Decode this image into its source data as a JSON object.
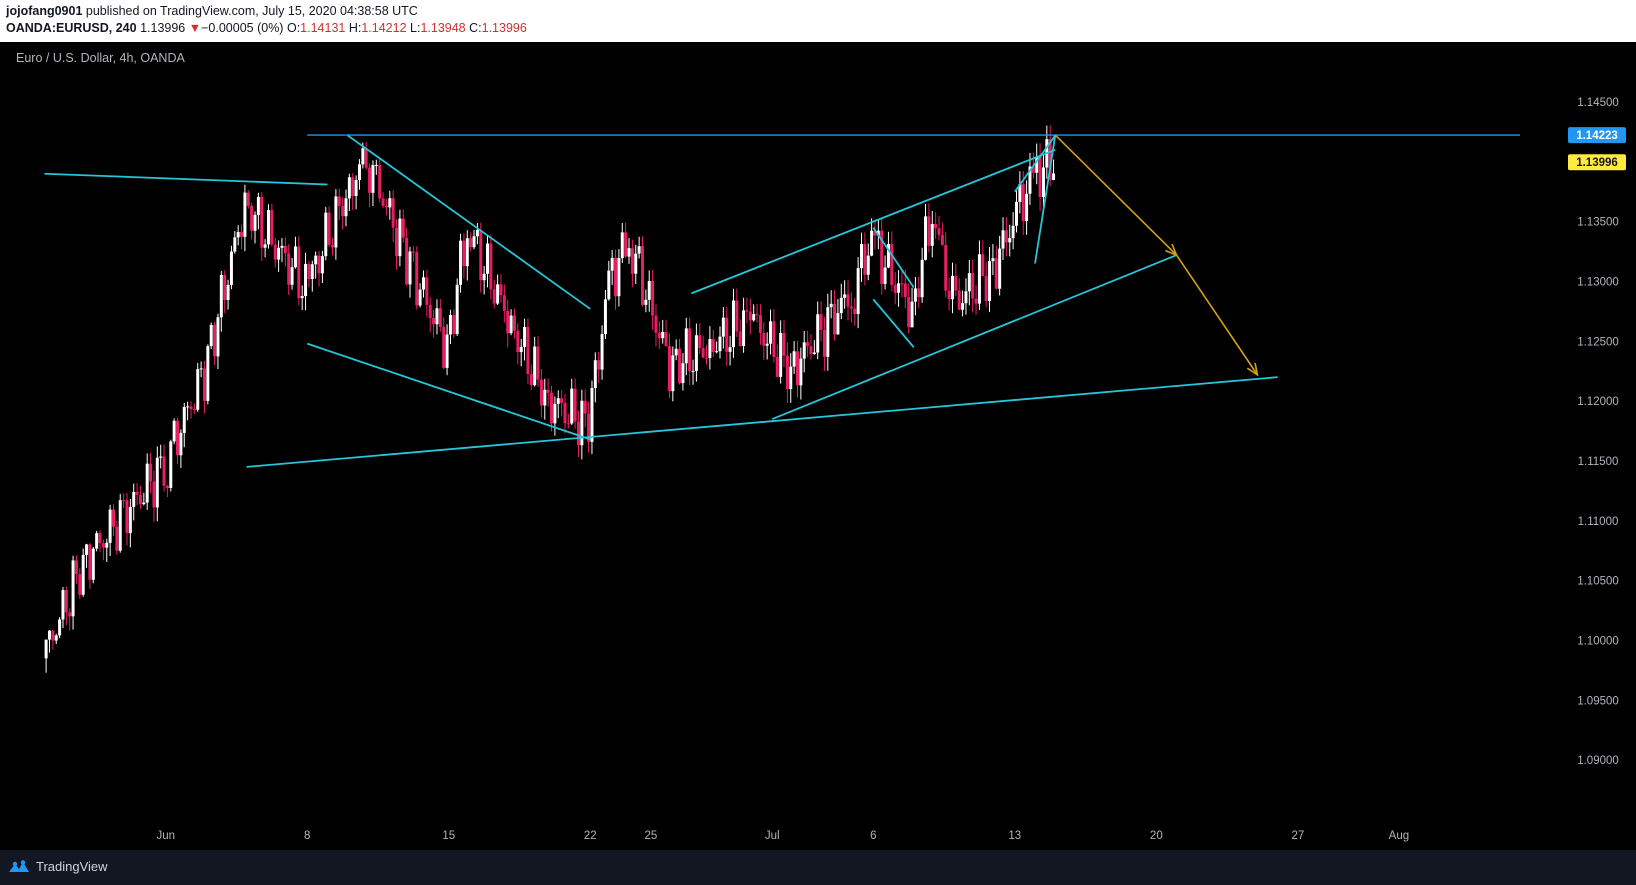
{
  "header": {
    "user": "jojofang0901",
    "published": "published on TradingView.com, July 15, 2020 04:38:58 UTC",
    "symbol": "OANDA:EURUSD, 240",
    "last": "1.13996",
    "change_arrow": "▼",
    "change": "−0.00005 (0%)",
    "o_label": "O:",
    "o_val": "1.14131",
    "h_label": "H:",
    "h_val": "1.14212",
    "l_label": "L:",
    "l_val": "1.13948",
    "c_label": "C:",
    "c_val": "1.13996"
  },
  "footer": {
    "brand": "TradingView",
    "logo_icon": "tradingview-logo-icon"
  },
  "colors": {
    "background": "#000000",
    "up_candle": "#ffffff",
    "down_candle": "#e91e63",
    "trendline": "#26c6da",
    "resistance": "#2196f3",
    "forecast": "#d4a017",
    "last_price_badge": "#ffeb3b",
    "resistance_badge": "#2196f3"
  },
  "chart_data": {
    "type": "candlestick",
    "title": "Euro / U.S. Dollar, 4h, OANDA",
    "x_tick_labels": [
      "Jun",
      "8",
      "15",
      "22",
      "25",
      "Jul",
      "6",
      "13",
      "20",
      "27",
      "Aug"
    ],
    "x_tick_dates": [
      "2020-06-01",
      "2020-06-08",
      "2020-06-15",
      "2020-06-22",
      "2020-06-25",
      "2020-07-01",
      "2020-07-06",
      "2020-07-13",
      "2020-07-20",
      "2020-07-27",
      "2020-08-01"
    ],
    "y_tick_labels": [
      "1.14500",
      "1.14000",
      "1.13500",
      "1.13000",
      "1.12500",
      "1.12000",
      "1.11500",
      "1.11000",
      "1.10500",
      "1.10000",
      "1.09500",
      "1.09000"
    ],
    "ylim": [
      1.0875,
      1.1475
    ],
    "last_price": 1.13996,
    "resistance_level": 1.14223,
    "price_badges": [
      {
        "label": "1.14223",
        "value": 1.14223,
        "kind": "resistance"
      },
      {
        "label": "1.13996",
        "value": 1.13996,
        "kind": "last"
      }
    ],
    "candles_envelope": [
      {
        "date": "2020-05-26",
        "close": 1.0985
      },
      {
        "date": "2020-05-28",
        "close": 1.1065
      },
      {
        "date": "2020-06-01",
        "close": 1.1145
      },
      {
        "date": "2020-06-03",
        "close": 1.1225
      },
      {
        "date": "2020-06-05",
        "close": 1.1365
      },
      {
        "date": "2020-06-08",
        "close": 1.1295
      },
      {
        "date": "2020-06-10",
        "close": 1.1372
      },
      {
        "date": "2020-06-11",
        "close": 1.1405
      },
      {
        "date": "2020-06-13",
        "close": 1.132
      },
      {
        "date": "2020-06-15",
        "close": 1.1245
      },
      {
        "date": "2020-06-16",
        "close": 1.1345
      },
      {
        "date": "2020-06-18",
        "close": 1.127
      },
      {
        "date": "2020-06-20",
        "close": 1.12
      },
      {
        "date": "2020-06-22",
        "close": 1.118
      },
      {
        "date": "2020-06-23",
        "close": 1.13
      },
      {
        "date": "2020-06-24",
        "close": 1.1335
      },
      {
        "date": "2020-06-26",
        "close": 1.123
      },
      {
        "date": "2020-06-28",
        "close": 1.1245
      },
      {
        "date": "2020-06-30",
        "close": 1.127
      },
      {
        "date": "2020-07-02",
        "close": 1.1225
      },
      {
        "date": "2020-07-05",
        "close": 1.129
      },
      {
        "date": "2020-07-06",
        "close": 1.1335
      },
      {
        "date": "2020-07-08",
        "close": 1.1275
      },
      {
        "date": "2020-07-09",
        "close": 1.136
      },
      {
        "date": "2020-07-10",
        "close": 1.128
      },
      {
        "date": "2020-07-12",
        "close": 1.131
      },
      {
        "date": "2020-07-13",
        "close": 1.135
      },
      {
        "date": "2020-07-14",
        "close": 1.139
      },
      {
        "date": "2020-07-15",
        "close": 1.13996
      }
    ],
    "drawings": [
      {
        "kind": "horizontal",
        "name": "resistance-line",
        "price": 1.14223,
        "from": "2020-06-08",
        "to": "2020-08-05"
      },
      {
        "kind": "trendline",
        "name": "prior-down-trendline",
        "from": [
          "2020-05-26",
          1.139
        ],
        "to": [
          "2020-06-09",
          1.1381
        ]
      },
      {
        "kind": "trendline",
        "name": "broadening-upper",
        "from": [
          "2020-06-10",
          1.1422
        ],
        "to": [
          "2020-06-22",
          1.1277
        ]
      },
      {
        "kind": "trendline",
        "name": "broadening-lower",
        "from": [
          "2020-06-08",
          1.1248
        ],
        "to": [
          "2020-06-22",
          1.1168
        ]
      },
      {
        "kind": "trendline",
        "name": "long-support",
        "from": [
          "2020-06-05",
          1.1145
        ],
        "to": [
          "2020-07-26",
          1.122
        ]
      },
      {
        "kind": "trendline",
        "name": "channel-upper",
        "from": [
          "2020-06-27",
          1.129
        ],
        "to": [
          "2020-07-15",
          1.141
        ]
      },
      {
        "kind": "trendline",
        "name": "channel-lower",
        "from": [
          "2020-07-01",
          1.1185
        ],
        "to": [
          "2020-07-21",
          1.1322
        ]
      },
      {
        "kind": "trendline",
        "name": "flag-top",
        "from": [
          "2020-07-06",
          1.1345
        ],
        "to": [
          "2020-07-08",
          1.1295
        ]
      },
      {
        "kind": "trendline",
        "name": "flag-bottom",
        "from": [
          "2020-07-06",
          1.1285
        ],
        "to": [
          "2020-07-08",
          1.1245
        ]
      },
      {
        "kind": "trendline",
        "name": "spike-left",
        "from": [
          "2020-07-13",
          1.1375
        ],
        "to": [
          "2020-07-15",
          1.1422
        ]
      },
      {
        "kind": "trendline",
        "name": "spike-right",
        "from": [
          "2020-07-14",
          1.1315
        ],
        "to": [
          "2020-07-15",
          1.1422
        ]
      }
    ],
    "forecast_path": [
      [
        "2020-07-15",
        1.14223
      ],
      [
        "2020-07-21",
        1.1322
      ],
      [
        "2020-07-25",
        1.1222
      ]
    ]
  }
}
